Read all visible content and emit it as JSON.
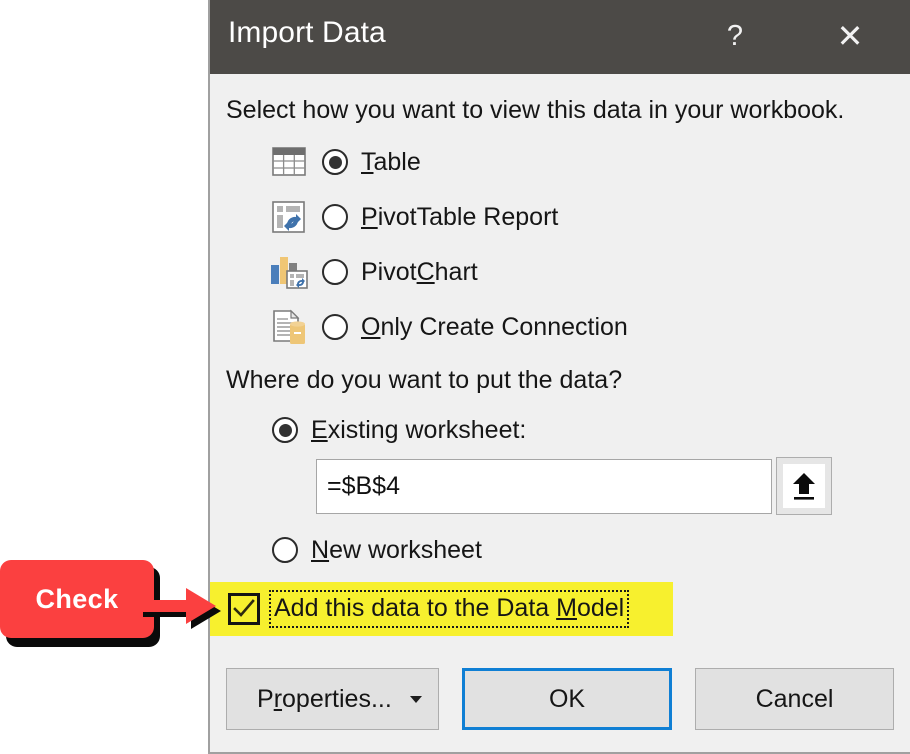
{
  "window": {
    "title": "Import Data",
    "help_label": "?",
    "close_label": "✕"
  },
  "view_section": {
    "prompt": "Select how you want to view this data in your workbook.",
    "selected": "Table",
    "options": [
      {
        "id": "table",
        "label_pre": "",
        "label_accel": "T",
        "label_post": "able",
        "icon": "table-icon",
        "checked": true
      },
      {
        "id": "pivottable",
        "label_pre": "",
        "label_accel": "P",
        "label_post": "ivotTable Report",
        "icon": "pivottable-icon",
        "checked": false
      },
      {
        "id": "pivotchart",
        "label_pre": "Pivot",
        "label_accel": "C",
        "label_post": "hart",
        "icon": "pivotchart-icon",
        "checked": false
      },
      {
        "id": "onlyconn",
        "label_pre": "",
        "label_accel": "O",
        "label_post": "nly Create Connection",
        "icon": "connection-icon",
        "checked": false
      }
    ]
  },
  "place_section": {
    "prompt": "Where do you want to put the data?",
    "existing": {
      "label_pre": "",
      "label_accel": "E",
      "label_post": "xisting worksheet:",
      "checked": true
    },
    "new": {
      "label_pre": "",
      "label_accel": "N",
      "label_post": "ew worksheet",
      "checked": false
    },
    "range_value": "=$B$4",
    "range_placeholder": "",
    "range_picker_icon": "collapse-dialog-icon"
  },
  "data_model": {
    "label_pre": "Add this data to the Data ",
    "label_accel": "M",
    "label_post": "odel",
    "checked": true,
    "highlight_color": "#f7f02e",
    "focused": true
  },
  "footer": {
    "properties": {
      "label_pre": "P",
      "label_accel": "r",
      "label_post": "operties...",
      "has_dropdown": true
    },
    "ok": "OK",
    "cancel": "Cancel",
    "default_button": "OK",
    "focus_color": "#0f7fd4"
  },
  "annotation": {
    "label": "Check",
    "box_color": "#fb4040",
    "text_color": "#ffffff",
    "arrow_color": "#fb4040",
    "points_to": "add-this-data-to-data-model-checkbox"
  }
}
